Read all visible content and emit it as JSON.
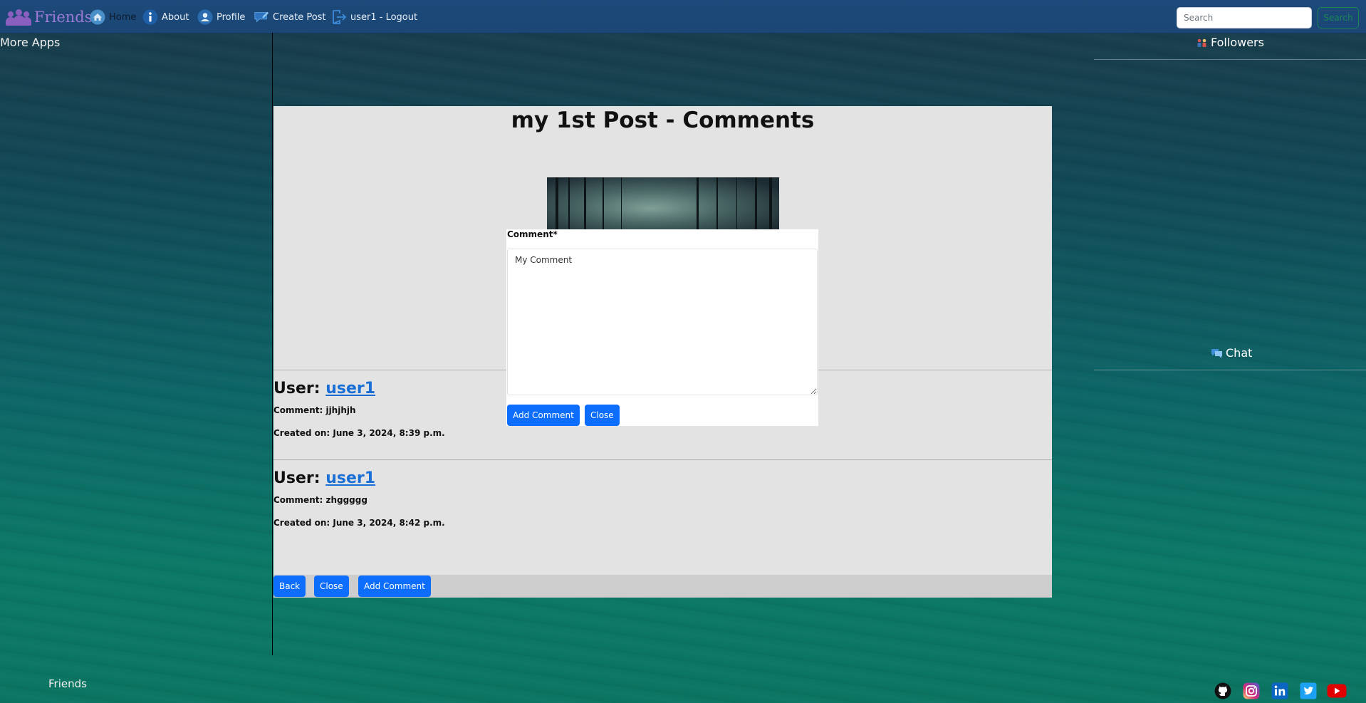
{
  "navbar": {
    "brand": "Friends",
    "items": [
      {
        "label": "Home",
        "icon": "home-icon",
        "active": true
      },
      {
        "label": "About",
        "icon": "info-icon"
      },
      {
        "label": "Profile",
        "icon": "profile-icon"
      },
      {
        "label": "Create Post",
        "icon": "create-post-icon"
      },
      {
        "label": "user1 - Logout",
        "icon": "logout-icon"
      }
    ],
    "search_placeholder": "Search",
    "search_button": "Search"
  },
  "left_sidebar": {
    "title": "More Apps"
  },
  "right_sidebar": {
    "followers_title": "Followers",
    "chat_title": "Chat"
  },
  "post": {
    "title": "my 1st Post - Comments",
    "comments": [
      {
        "user_prefix": "User:",
        "user": "user1",
        "comment": "Comment: jjhjhjh",
        "created": "Created on: June 3, 2024, 8:39 p.m."
      },
      {
        "user_prefix": "User:",
        "user": "user1",
        "comment": "Comment: zhggggg",
        "created": "Created on: June 3, 2024, 8:42 p.m."
      }
    ],
    "buttons": {
      "back": "Back",
      "close": "Close",
      "add_comment": "Add Comment"
    }
  },
  "modal": {
    "label": "Comment*",
    "textarea_value": "My Comment",
    "add_comment": "Add Comment",
    "close": "Close"
  },
  "footer": {
    "name": "Friends",
    "social": [
      "github-icon",
      "instagram-icon",
      "linkedin-icon",
      "twitter-icon",
      "youtube-icon"
    ]
  },
  "colors": {
    "primary": "#0d6efd",
    "navbar": "#1c4a7a",
    "success": "#198754",
    "brand": "#9c7ad6"
  }
}
